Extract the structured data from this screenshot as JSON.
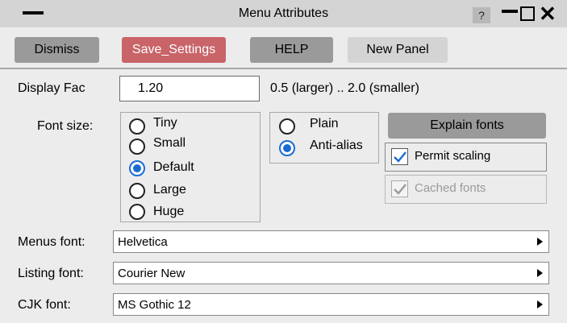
{
  "window": {
    "title": "Menu Attributes",
    "help_icon": "?"
  },
  "toolbar": {
    "dismiss": "Dismiss",
    "save_settings": "Save_Settings",
    "help": "HELP",
    "new_panel": "New Panel"
  },
  "display_fac": {
    "label": "Display Fac",
    "value": "1.20",
    "range_note": "0.5 (larger) .. 2.0 (smaller)"
  },
  "font_size": {
    "label": "Font size:",
    "options": [
      "Tiny",
      "Small",
      "Default",
      "Large",
      "Huge"
    ],
    "selected": "Default"
  },
  "render_mode": {
    "options": [
      "Plain",
      "Anti-alias"
    ],
    "selected": "Anti-alias"
  },
  "explain_fonts": "Explain fonts",
  "permit_scaling": {
    "label": "Permit scaling",
    "checked": true
  },
  "cached_fonts": {
    "label": "Cached fonts",
    "checked": true,
    "disabled": true
  },
  "menus_font": {
    "label": "Menus font:",
    "value": "Helvetica"
  },
  "listing_font": {
    "label": "Listing font:",
    "value": "Courier New"
  },
  "cjk_font": {
    "label": "CJK font:",
    "value": "MS Gothic 12"
  },
  "colors": {
    "accent": "#1a6bd1",
    "save_button": "#c96469",
    "title_bar": "#d4d4d4",
    "panel": "#ececec"
  }
}
